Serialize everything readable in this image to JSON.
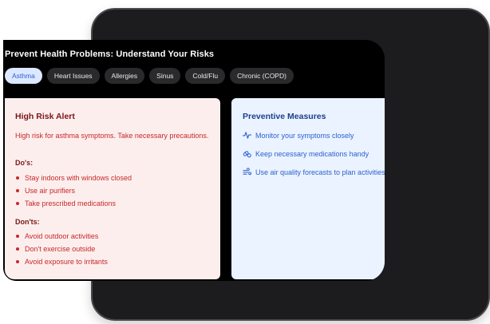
{
  "page": {
    "title": "Prevent Health Problems: Understand Your Risks"
  },
  "tabs": [
    {
      "label": "Asthma",
      "active": true
    },
    {
      "label": "Heart Issues",
      "active": false
    },
    {
      "label": "Allergies",
      "active": false
    },
    {
      "label": "Sinus",
      "active": false
    },
    {
      "label": "Cold/Flu",
      "active": false
    },
    {
      "label": "Chronic (COPD)",
      "active": false
    }
  ],
  "risk": {
    "title": "High Risk Alert",
    "description": "High risk for asthma symptoms. Take necessary precautions.",
    "dos_heading": "Do's:",
    "dos": [
      "Stay indoors with windows closed",
      "Use air purifiers",
      "Take prescribed medications"
    ],
    "donts_heading": "Don'ts:",
    "donts": [
      "Avoid outdoor activities",
      "Don't exercise outside",
      "Avoid exposure to irritants"
    ]
  },
  "preventive": {
    "title": "Preventive Measures",
    "items": [
      {
        "icon": "activity-icon",
        "label": "Monitor your symptoms closely"
      },
      {
        "icon": "pills-icon",
        "label": "Keep necessary medications handy"
      },
      {
        "icon": "wind-icon",
        "label": "Use air quality forecasts to plan activities"
      }
    ]
  },
  "colors": {
    "accent": "#2d5fd0",
    "alert": "#c62828",
    "alert_bg": "#fdeeee",
    "preventive_bg": "#eaf3ff"
  }
}
